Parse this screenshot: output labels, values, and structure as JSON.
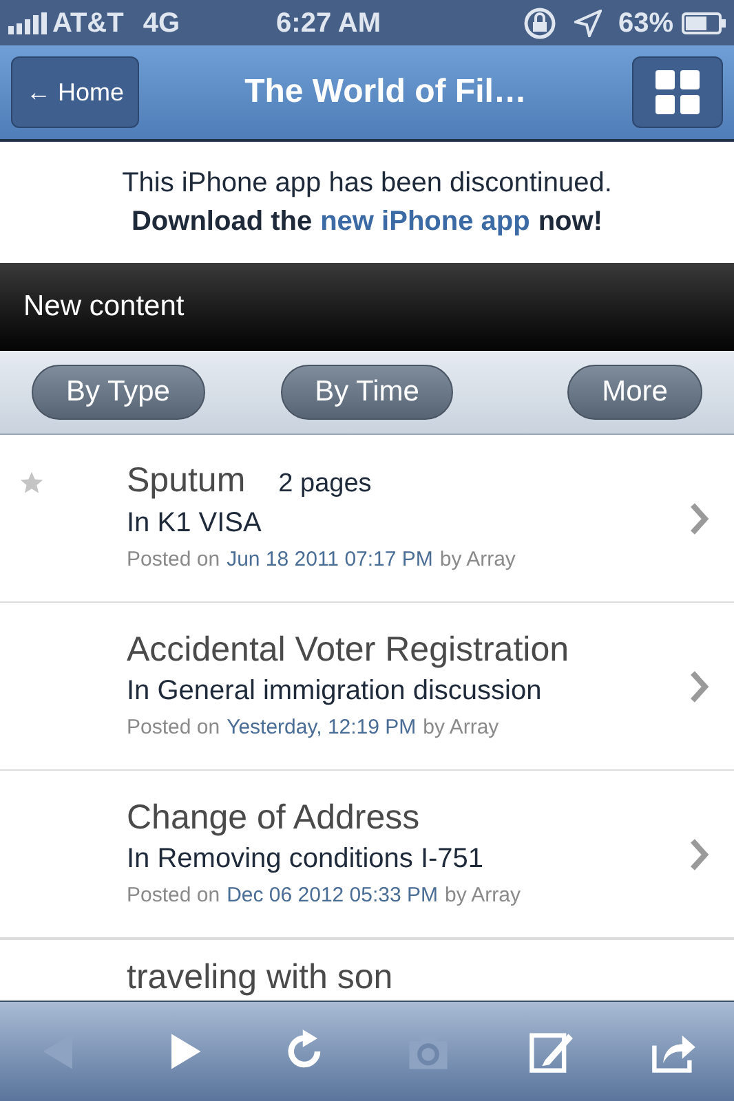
{
  "status_bar": {
    "carrier": "AT&T",
    "network": "4G",
    "time": "6:27 AM",
    "battery": "63%"
  },
  "nav_bar": {
    "back": "← Home",
    "title": "The World of Fil…"
  },
  "notice": {
    "line_1": "This iPhone app has been discontinued.",
    "line_2_before": "Download the",
    "link": "new iPhone app",
    "line_2_after": "now!"
  },
  "section": {
    "title": "New content"
  },
  "filters": [
    {
      "label": "By Type"
    },
    {
      "label": "By Time"
    },
    {
      "label": "More"
    }
  ],
  "rows": [
    {
      "title": "Sputum",
      "pages": "2 pages",
      "forum": "In K1 VISA",
      "posted_on": "Posted on",
      "date": "Jun 18 2011 07:17 PM",
      "by": "by Array",
      "starred": true
    },
    {
      "title": "Accidental Voter Registration",
      "forum": "In General immigration discussion",
      "posted_on": "Posted on",
      "date": "Yesterday, 12:19 PM",
      "by": "by Array",
      "starred": false
    },
    {
      "title": "Change of Address",
      "forum": "In Removing conditions I-751",
      "posted_on": "Posted on",
      "date": "Dec 06 2012 05:33 PM",
      "by": "by Array",
      "starred": false
    },
    {
      "title": "traveling with son",
      "starred": false
    }
  ],
  "toolbar": [
    {
      "kind": "back",
      "disabled": true
    },
    {
      "kind": "forward",
      "disabled": false
    },
    {
      "kind": "reload",
      "disabled": false
    },
    {
      "kind": "camera",
      "disabled": true
    },
    {
      "kind": "compose",
      "disabled": false
    },
    {
      "kind": "share",
      "disabled": false
    }
  ]
}
